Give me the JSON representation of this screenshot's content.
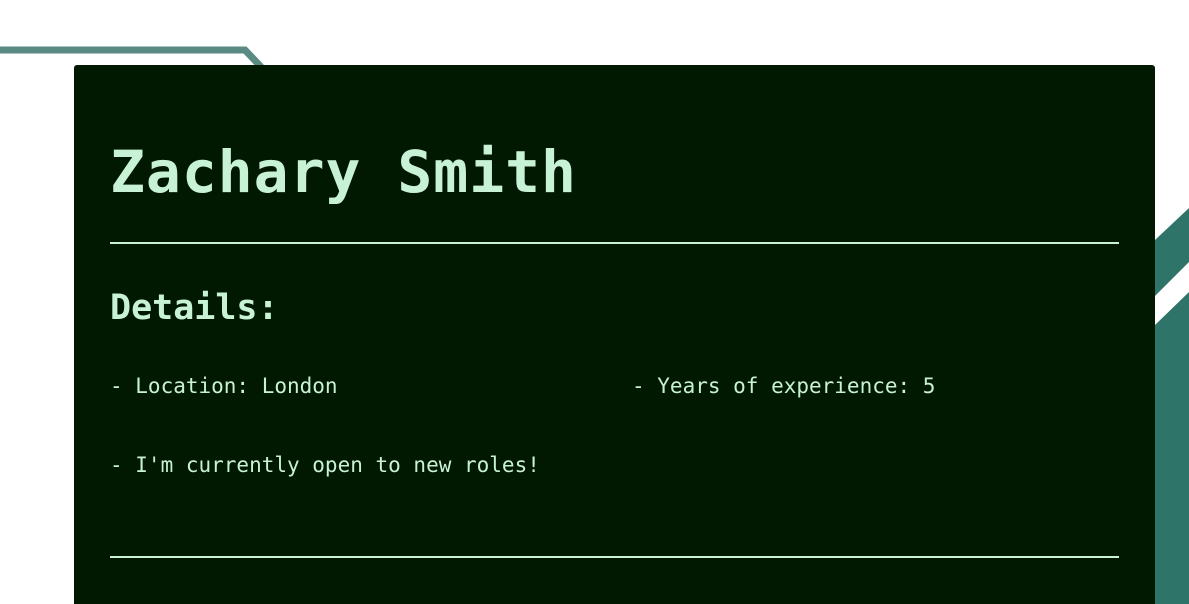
{
  "profile": {
    "name": "Zachary Smith"
  },
  "details": {
    "heading": "Details:",
    "location": "- Location: London",
    "experience": "- Years of experience: 5",
    "availability": "- I'm currently open to new roles!"
  },
  "colors": {
    "card_background": "#011801",
    "text": "#c8f2d6",
    "accent_lines": "#5a8a82",
    "accent_teal": "#2f7468",
    "page_background": "#ffffff"
  }
}
